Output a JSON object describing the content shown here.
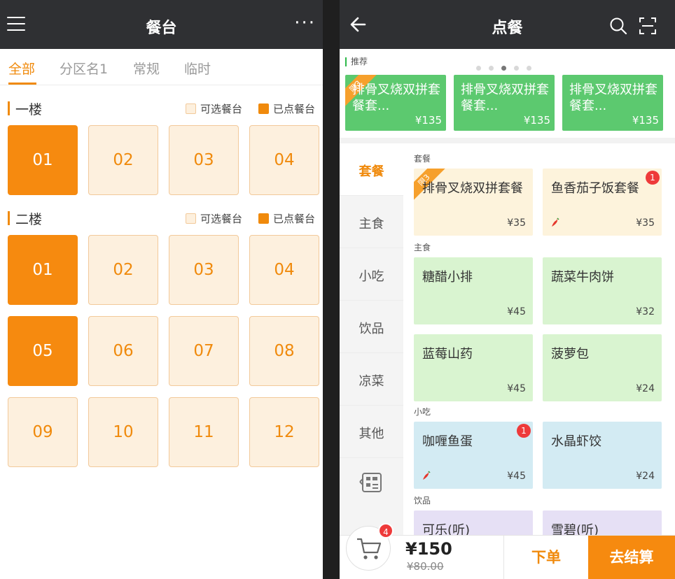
{
  "left": {
    "title": "餐台",
    "tabs": [
      "全部",
      "分区名1",
      "常规",
      "临时"
    ],
    "legend": {
      "available": "可选餐台",
      "occupied": "已点餐台"
    },
    "floors": [
      {
        "name": "一楼",
        "tables": [
          {
            "no": "01",
            "status": "occupied"
          },
          {
            "no": "02",
            "status": "available"
          },
          {
            "no": "03",
            "status": "available"
          },
          {
            "no": "04",
            "status": "available"
          }
        ]
      },
      {
        "name": "二楼",
        "tables": [
          {
            "no": "01",
            "status": "occupied"
          },
          {
            "no": "02",
            "status": "available"
          },
          {
            "no": "03",
            "status": "available"
          },
          {
            "no": "04",
            "status": "available"
          },
          {
            "no": "05",
            "status": "occupied"
          },
          {
            "no": "06",
            "status": "available"
          },
          {
            "no": "07",
            "status": "available"
          },
          {
            "no": "08",
            "status": "available"
          },
          {
            "no": "09",
            "status": "available"
          },
          {
            "no": "10",
            "status": "available"
          },
          {
            "no": "11",
            "status": "available"
          },
          {
            "no": "12",
            "status": "available"
          }
        ]
      }
    ]
  },
  "right": {
    "title": "点餐",
    "recommend": {
      "label": "推荐",
      "carousel_active_index": 2,
      "carousel_count": 5,
      "cards": [
        {
          "name": "排骨叉烧双拼套餐套...",
          "price": "¥135",
          "ribbon": "限3"
        },
        {
          "name": "排骨叉烧双拼套餐套...",
          "price": "¥135"
        },
        {
          "name": "排骨叉烧双拼套餐套...",
          "price": "¥135"
        }
      ]
    },
    "categories": [
      "套餐",
      "主食",
      "小吃",
      "饮品",
      "凉菜",
      "其他"
    ],
    "active_category": "套餐",
    "groups": [
      {
        "title": "套餐",
        "dishes": [
          {
            "name": "排骨叉烧双拼套餐",
            "price": "¥35",
            "ribbon": "限3"
          },
          {
            "name": "鱼香茄子饭套餐",
            "price": "¥35",
            "badge": "1",
            "spicy": true
          }
        ]
      },
      {
        "title": "主食",
        "dishes": [
          {
            "name": "糖醋小排",
            "price": "¥45"
          },
          {
            "name": "蔬菜牛肉饼",
            "price": "¥32"
          },
          {
            "name": "蓝莓山药",
            "price": "¥45"
          },
          {
            "name": "菠萝包",
            "price": "¥24"
          }
        ]
      },
      {
        "title": "小吃",
        "dishes": [
          {
            "name": "咖喱鱼蛋",
            "price": "¥45",
            "badge": "1",
            "spicy": true
          },
          {
            "name": "水晶虾饺",
            "price": "¥24"
          }
        ]
      },
      {
        "title": "饮品",
        "dishes": [
          {
            "name": "可乐(听)"
          },
          {
            "name": "雪碧(听)"
          }
        ]
      }
    ],
    "cart": {
      "count": "4",
      "total": "¥150",
      "original": "¥80.00"
    },
    "order_label": "下单",
    "checkout_label": "去结算"
  },
  "colors": {
    "accent": "#f68a0f",
    "recommend_card": "#5cc96f",
    "badge": "#ee3a3a",
    "set_tile": "#fdf3dc",
    "main_tile": "#d9f4d0",
    "snack_tile": "#d3ebf3",
    "drink_tile": "#e6e0f5"
  }
}
